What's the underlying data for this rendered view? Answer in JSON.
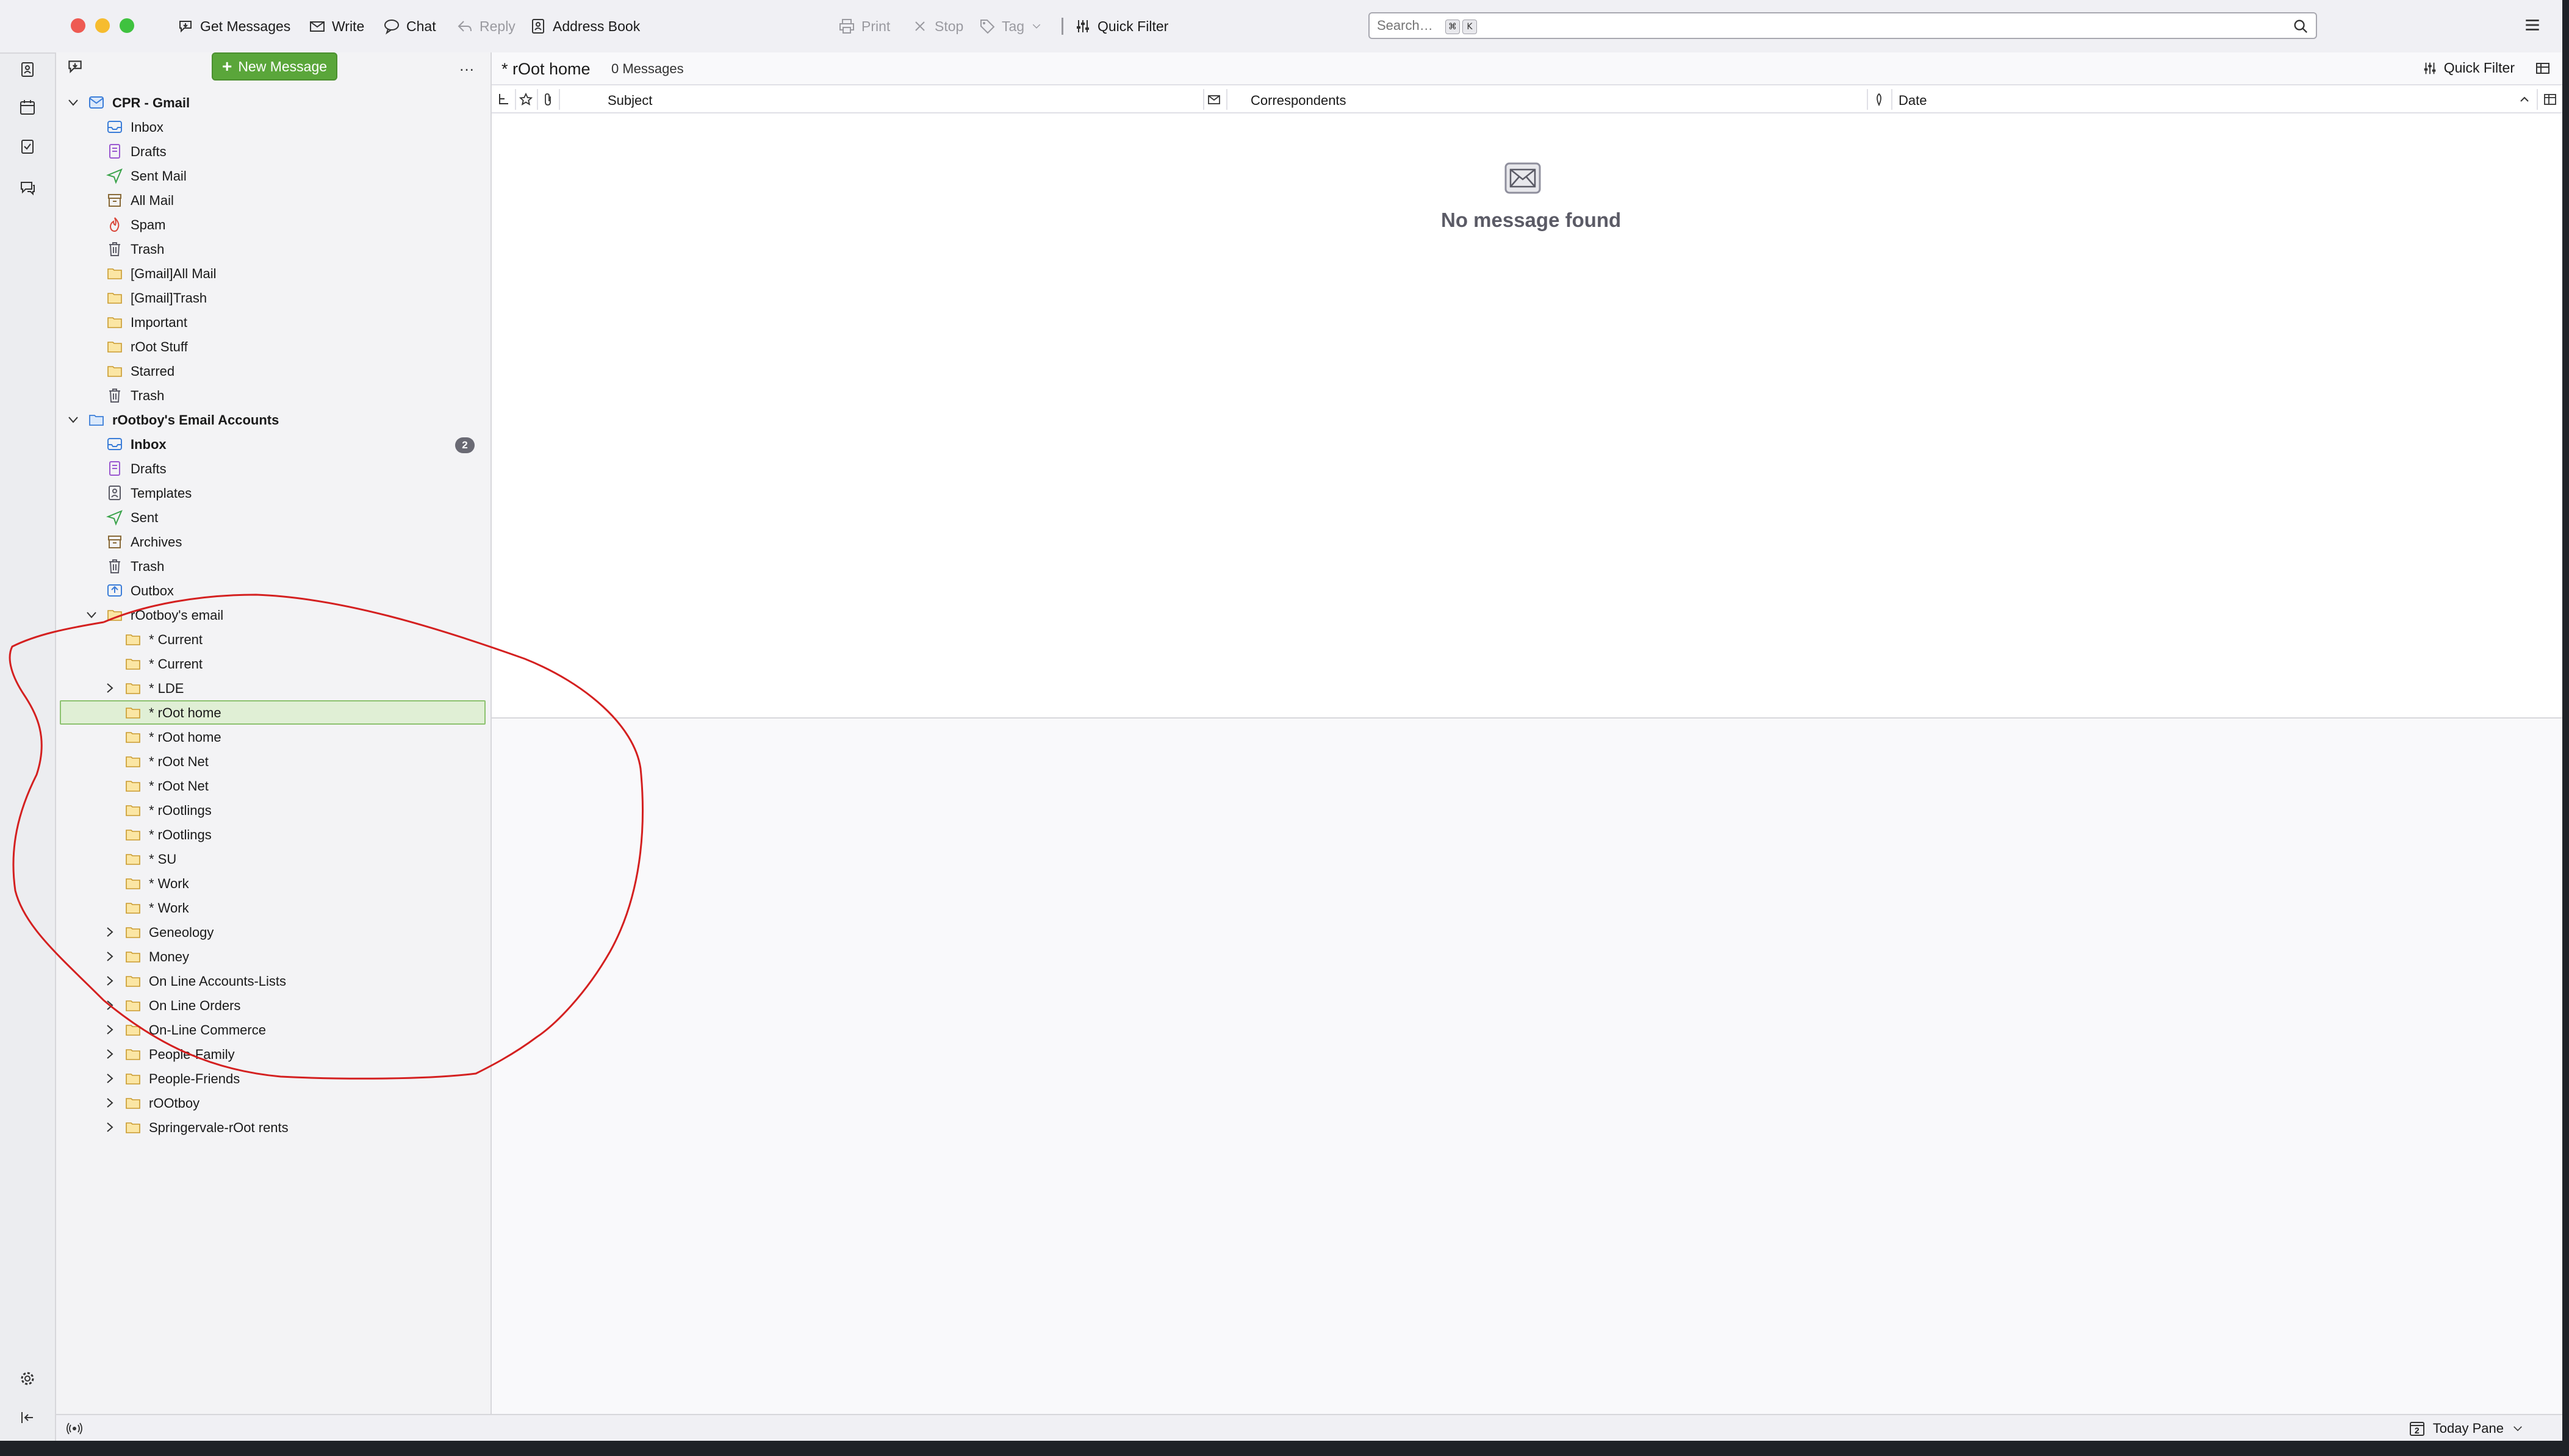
{
  "toolbar": {
    "get_messages": "Get Messages",
    "write": "Write",
    "chat": "Chat",
    "reply": "Reply",
    "address_book": "Address Book",
    "print": "Print",
    "stop": "Stop",
    "tag": "Tag",
    "quick_filter": "Quick Filter",
    "search_placeholder": "Search…",
    "shortcut_keys": [
      "⌘",
      "K"
    ],
    "menu_icon": "hamburger-menu-icon"
  },
  "spaces": [
    "mail-icon",
    "address-book-icon",
    "calendar-icon",
    "tasks-icon",
    "chat-icon",
    "settings-icon",
    "collapse-icon"
  ],
  "folder_pane": {
    "new_message": "New Message",
    "menu": "…",
    "accounts": [
      {
        "name": "CPR - Gmail",
        "folders": [
          "Inbox",
          "Drafts",
          "Sent Mail",
          "All Mail",
          "Spam",
          "Trash",
          "[Gmail]All Mail",
          "[Gmail]Trash",
          "Important",
          "rOot Stuff",
          "Starred",
          "Trash"
        ]
      },
      {
        "name": "rOotboy's Email Accounts",
        "inbox_unread": "2",
        "folders": [
          "Inbox",
          "Drafts",
          "Templates",
          "Sent",
          "Archives",
          "Trash",
          "Outbox",
          "rOotboy's email"
        ],
        "subfolders": [
          "* Current",
          "* Current",
          "* LDE",
          "* rOot home",
          "* rOot home",
          "* rOot Net",
          "* rOot Net",
          "* rOotlings",
          "* rOotlings",
          "* SU",
          "* Work",
          "* Work",
          "Geneology",
          "Money",
          "On Line Accounts-Lists",
          "On Line Orders",
          "On-Line Commerce",
          "People-Family",
          "People-Friends",
          "rOOtboy",
          "Springervale-rOot rents"
        ]
      }
    ]
  },
  "thread_pane": {
    "folder_title": "* rOot home",
    "message_count": "0 Messages",
    "quick_filter": "Quick Filter",
    "columns": {
      "subject": "Subject",
      "correspondents": "Correspondents",
      "date": "Date"
    },
    "empty_text": "No message found"
  },
  "status_bar": {
    "today_pane": "Today Pane",
    "today_day": "2"
  },
  "colors": {
    "accent_green": "#5aa63a",
    "selection_bg": "#e0efd5",
    "annotation_red": "#d42020"
  }
}
